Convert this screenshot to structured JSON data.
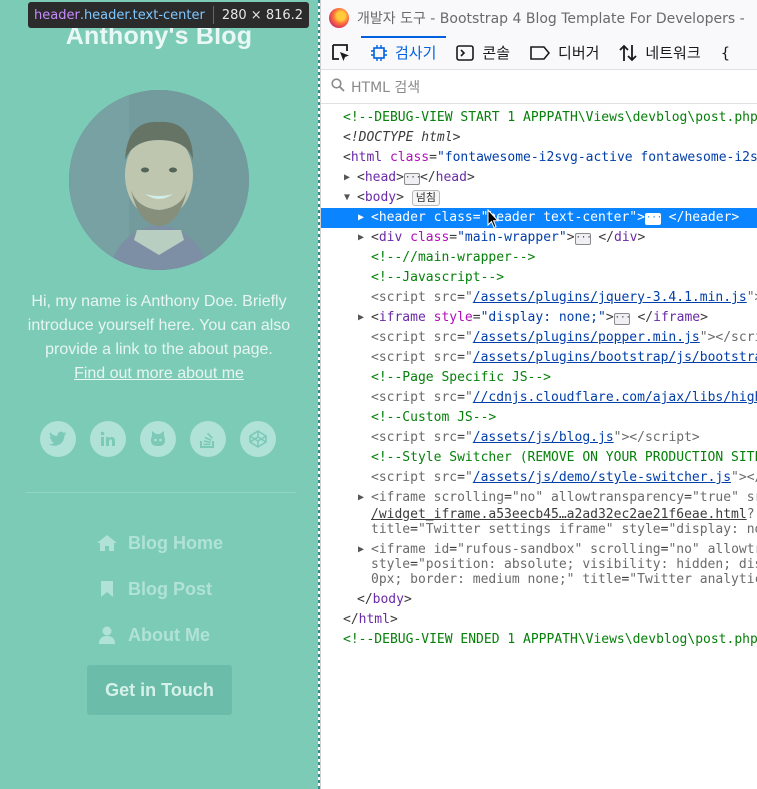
{
  "tooltip": {
    "tag": "header",
    "classes": ".header.text-center",
    "dims": "280 × 816.2"
  },
  "blog": {
    "title": "Anthony's Blog",
    "intro": "Hi, my name is Anthony Doe. Briefly introduce yourself here. You can also provide a link to the about page.",
    "intro_link": "Find out more about me",
    "social": [
      {
        "icon": "twitter-icon",
        "glyph": "t"
      },
      {
        "icon": "linkedin-icon",
        "glyph": "in"
      },
      {
        "icon": "github-icon",
        "glyph": "◉"
      },
      {
        "icon": "stackoverflow-icon",
        "glyph": "≡"
      },
      {
        "icon": "codepen-icon",
        "glyph": "◇"
      }
    ],
    "nav": [
      {
        "icon": "home-icon",
        "label": "Blog Home"
      },
      {
        "icon": "bookmark-icon",
        "label": "Blog Post"
      },
      {
        "icon": "user-icon",
        "label": "About Me"
      }
    ],
    "cta": "Get in Touch",
    "colors": {
      "bg": "#7ccbb7",
      "button": "#6cbcaa"
    }
  },
  "devtools": {
    "window_title": "개발자 도구 - Bootstrap 4 Blog Template For Developers - ",
    "tabs": [
      {
        "icon": "inspector-icon",
        "label": "검사기"
      },
      {
        "icon": "console-icon",
        "label": "콘솔"
      },
      {
        "icon": "debugger-icon",
        "label": "디버거"
      },
      {
        "icon": "network-icon",
        "label": "네트워크"
      }
    ],
    "more_tab": "{",
    "search_placeholder": "HTML 검색",
    "overflow_badge": "넘침",
    "selection_color": "#0a84ff",
    "accent_color": "#0061e0"
  }
}
